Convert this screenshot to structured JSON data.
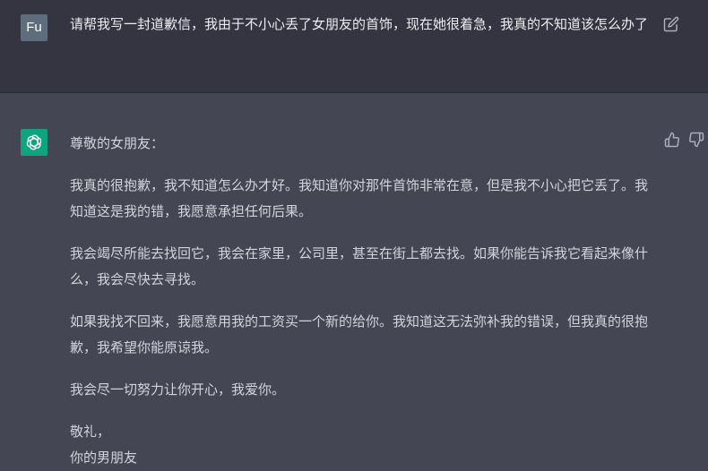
{
  "user_message": {
    "avatar_initials": "Fu",
    "text": "请帮我写一封道歉信，我由于不小心丢了女朋友的首饰，现在她很着急，我真的不知道该怎么办了"
  },
  "assistant_message": {
    "greeting": "尊敬的女朋友：",
    "paragraphs": [
      "我真的很抱歉，我不知道怎么办才好。我知道你对那件首饰非常在意，但是我不小心把它丢了。我知道这是我的错，我愿意承担任何后果。",
      "我会竭尽所能去找回它，我会在家里，公司里，甚至在街上都去找。如果你能告诉我它看起来像什么，我会尽快去寻找。",
      "如果我找不回来，我愿意用我的工资买一个新的给你。我知道这无法弥补我的错误，但我真的很抱歉，我希望你能原谅我。",
      "我会尽一切努力让你开心，我爱你。"
    ],
    "closing": "敬礼，",
    "signature": "你的男朋友"
  },
  "colors": {
    "user_bg": "#343541",
    "assistant_bg": "#444654",
    "bot_avatar": "#10a37f",
    "user_avatar": "#5d6d7b"
  },
  "icons": {
    "edit": "edit-icon",
    "thumb_up": "thumb-up-icon",
    "thumb_down": "thumb-down-icon",
    "bot": "openai-logo-icon"
  }
}
